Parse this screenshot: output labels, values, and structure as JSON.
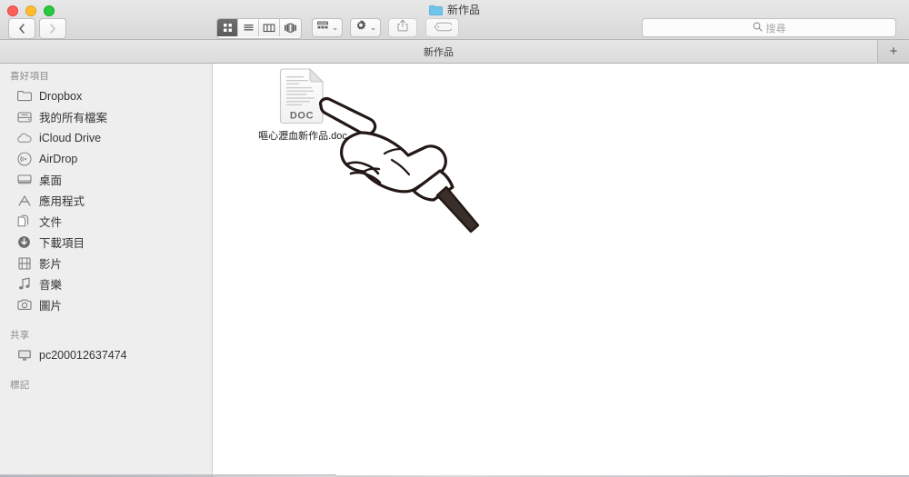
{
  "window": {
    "title": "新作品",
    "controls": [
      "close",
      "minimize",
      "maximize"
    ]
  },
  "toolbar": {
    "back_label": "‹",
    "forward_label": "›",
    "view_modes": [
      {
        "name": "icon-view",
        "label": "Icon",
        "active": true
      },
      {
        "name": "list-view",
        "label": "List",
        "active": false
      },
      {
        "name": "column-view",
        "label": "Column",
        "active": false
      },
      {
        "name": "coverflow-view",
        "label": "Cover Flow",
        "active": false
      }
    ],
    "arrange_label": "",
    "action_label": "",
    "share_label": "",
    "tag_label": "",
    "chevron": "⌄"
  },
  "search": {
    "placeholder": "搜尋",
    "value": ""
  },
  "tabbar": {
    "tabs": [
      {
        "label": "新作品",
        "active": true
      }
    ],
    "add_label": "+"
  },
  "sidebar": {
    "sections": [
      {
        "header": "喜好項目",
        "items": [
          {
            "label": "Dropbox",
            "icon": "folder-icon"
          },
          {
            "label": "我的所有檔案",
            "icon": "all-files-icon"
          },
          {
            "label": "iCloud Drive",
            "icon": "cloud-icon"
          },
          {
            "label": "AirDrop",
            "icon": "airdrop-icon"
          },
          {
            "label": "桌面",
            "icon": "desktop-icon"
          },
          {
            "label": "應用程式",
            "icon": "applications-icon"
          },
          {
            "label": "文件",
            "icon": "documents-icon"
          },
          {
            "label": "下載項目",
            "icon": "downloads-icon"
          },
          {
            "label": "影片",
            "icon": "movies-icon"
          },
          {
            "label": "音樂",
            "icon": "music-icon"
          },
          {
            "label": "圖片",
            "icon": "pictures-icon"
          }
        ]
      },
      {
        "header": "共享",
        "items": [
          {
            "label": "pc200012637474",
            "icon": "computer-icon"
          }
        ]
      },
      {
        "header": "標記",
        "items": []
      }
    ]
  },
  "content": {
    "files": [
      {
        "name": "嘔心瀝血新作品.doc",
        "icon": "doc-file-icon",
        "badge": "DOC"
      }
    ],
    "annotation": {
      "name": "pointing-hand-illustration"
    }
  },
  "colors": {
    "titlebar_top": "#e8e8e8",
    "titlebar_bottom": "#d8d8d8",
    "sidebar_bg": "#eeeeee",
    "content_bg": "#ffffff",
    "close": "#ff5f57",
    "minimize": "#ffbd2e",
    "maximize": "#28c940",
    "folder_blue": "#6fc4ea",
    "text": "#333333",
    "muted_text": "#8b8b8b"
  }
}
